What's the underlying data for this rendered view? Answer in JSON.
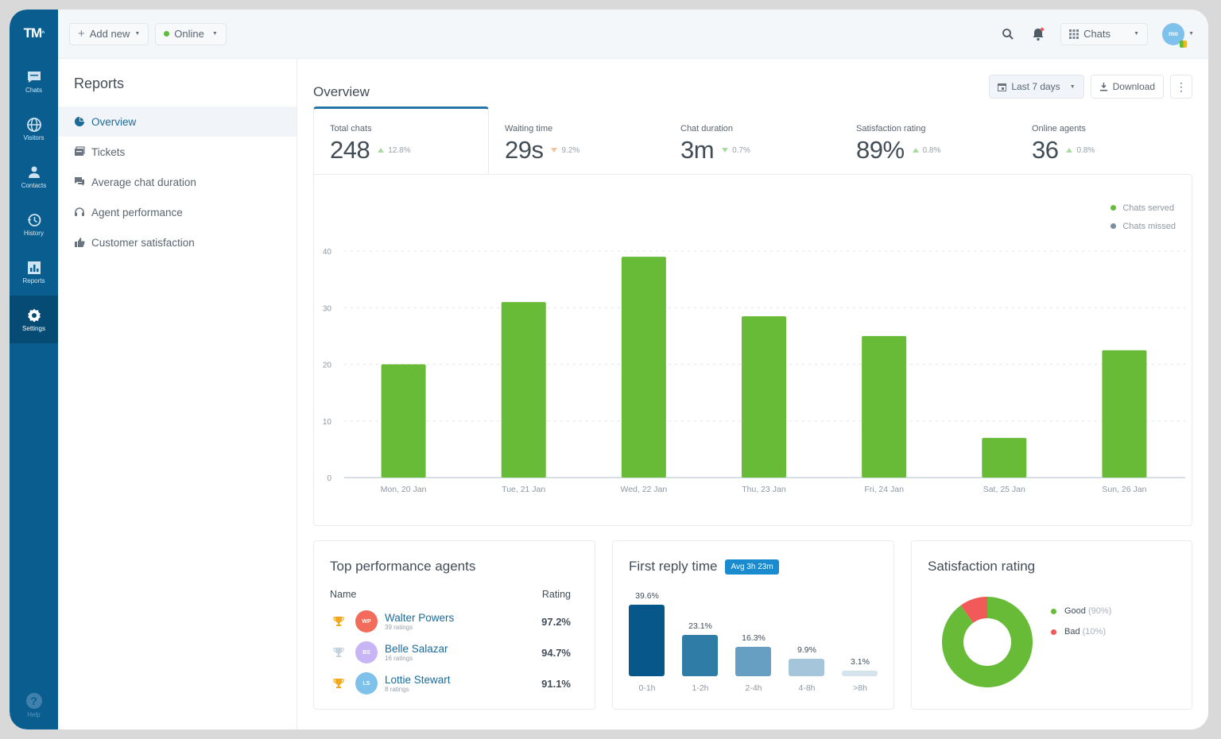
{
  "brand": {
    "logo": "TM",
    "primary": "#0a5e8f",
    "accent": "#2476a8",
    "green": "#67bb37",
    "red": "#f25a5a"
  },
  "nav": {
    "items": [
      {
        "label": "Chats",
        "icon": "chat-icon"
      },
      {
        "label": "Visitors",
        "icon": "globe-icon"
      },
      {
        "label": "Contacts",
        "icon": "person-icon"
      },
      {
        "label": "History",
        "icon": "history-icon"
      },
      {
        "label": "Reports",
        "icon": "reports-icon"
      },
      {
        "label": "Settings",
        "icon": "gear-icon",
        "active": true
      }
    ],
    "help": "Help"
  },
  "topbar": {
    "add_new": "Add new",
    "status": "Online",
    "status_color": "#5cbd3a",
    "app_switch": "Chats",
    "user_initials": "mo"
  },
  "sidebar": {
    "title": "Reports",
    "items": [
      {
        "label": "Overview",
        "icon": "pie-chart-icon",
        "active": true
      },
      {
        "label": "Tickets",
        "icon": "ticket-icon"
      },
      {
        "label": "Average chat duration",
        "icon": "chat-bubbles-icon"
      },
      {
        "label": "Agent performance",
        "icon": "headset-icon"
      },
      {
        "label": "Customer satisfaction",
        "icon": "thumbs-up-icon"
      }
    ]
  },
  "main": {
    "title": "Overview",
    "date_range": "Last 7 days",
    "download": "Download",
    "stats": [
      {
        "label": "Total chats",
        "value": "248",
        "change": "12.8%",
        "trend": "up"
      },
      {
        "label": "Waiting time",
        "value": "29s",
        "change": "9.2%",
        "trend": "down-bad"
      },
      {
        "label": "Chat duration",
        "value": "3m",
        "change": "0.7%",
        "trend": "down-good"
      },
      {
        "label": "Satisfaction rating",
        "value": "89%",
        "change": "0.8%",
        "trend": "up"
      },
      {
        "label": "Online agents",
        "value": "36",
        "change": "0.8%",
        "trend": "up"
      }
    ]
  },
  "chart_data": [
    {
      "type": "bar",
      "title": "Total chats",
      "categories": [
        "Mon, 20 Jan",
        "Tue, 21 Jan",
        "Wed, 22 Jan",
        "Thu, 23 Jan",
        "Fri, 24 Jan",
        "Sat, 25 Jan",
        "Sun, 26 Jan"
      ],
      "series": [
        {
          "name": "Chats served",
          "color": "#67bb37",
          "values": [
            20,
            31,
            39,
            28.5,
            25,
            7,
            22.5
          ]
        },
        {
          "name": "Chats missed",
          "color": "#7d8ea3",
          "values": []
        }
      ],
      "yticks": [
        0,
        10,
        20,
        30,
        40
      ],
      "ylim": [
        0,
        40
      ],
      "grid": true,
      "legend": "top-right"
    },
    {
      "type": "bar",
      "title": "First reply time",
      "badge": "Avg 3h 23m",
      "categories": [
        "0-1h",
        "1-2h",
        "2-4h",
        "4-8h",
        ">8h"
      ],
      "values": [
        39.6,
        23.1,
        16.3,
        9.9,
        3.1
      ],
      "labels": [
        "39.6%",
        "23.1%",
        "16.3%",
        "9.9%",
        "3.1%"
      ],
      "colors": [
        "#07578a",
        "#2f7ca7",
        "#669fc2",
        "#a4c5da",
        "#d5e3ec"
      ]
    },
    {
      "type": "pie",
      "title": "Satisfaction rating",
      "slices": [
        {
          "name": "Good",
          "pct_label": "(90%)",
          "value": 90,
          "color": "#67bb37"
        },
        {
          "name": "Bad",
          "pct_label": "(10%)",
          "value": 10,
          "color": "#f25a5a"
        }
      ]
    }
  ],
  "agents": {
    "title": "Top performance agents",
    "col_name": "Name",
    "col_rating": "Rating",
    "rows": [
      {
        "initials": "WP",
        "name": "Walter Powers",
        "ratings": "39 ratings",
        "rating": "97.2%",
        "color": "#f26b5b",
        "trophy": "#f3a81c"
      },
      {
        "initials": "BS",
        "name": "Belle Salazar",
        "ratings": "16 ratings",
        "rating": "94.7%",
        "color": "#c7b5f5",
        "trophy": "#c5d3de"
      },
      {
        "initials": "LS",
        "name": "Lottie Stewart",
        "ratings": "8 ratings",
        "rating": "91.1%",
        "color": "#7ec2ec",
        "trophy": "#f3a81c"
      }
    ]
  }
}
